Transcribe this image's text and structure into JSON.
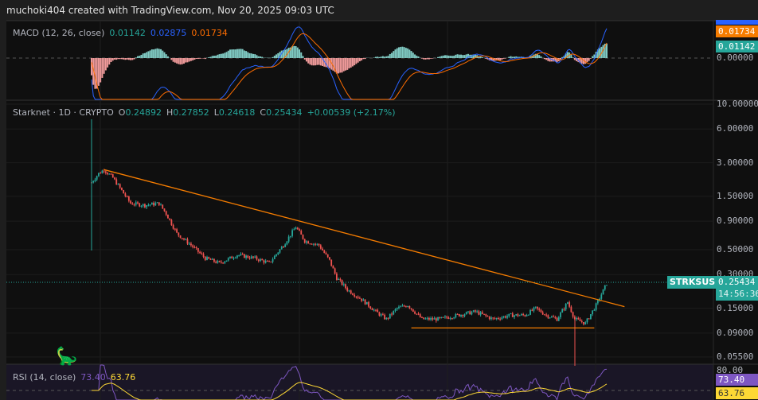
{
  "header": {
    "title": "muchoki404 created with TradingView.com, Nov 20, 2025 09:03 UTC"
  },
  "macd": {
    "label": "MACD (12, 26, close)",
    "hist": "0.01142",
    "macd": "0.02875",
    "signal": "0.01734",
    "axis_zero": "0.00000"
  },
  "price": {
    "symbol_line": "Starknet · 1D · CRYPTO",
    "o_label": "O",
    "o": "0.24892",
    "h_label": "H",
    "h": "0.27852",
    "l_label": "L",
    "l": "0.24618",
    "c_label": "C",
    "c": "0.25434",
    "change": "+0.00539 (+2.17%)",
    "ticker": "STRKSUSD",
    "last": "0.25434",
    "countdown": "14:56:36"
  },
  "rsi": {
    "label": "RSI (14, close)",
    "rsi": "73.40",
    "ma": "63.76",
    "axis_top": "80.00"
  },
  "colors": {
    "up": "#26a69a",
    "down": "#ef5350",
    "macd": "#2962ff",
    "signal": "#ff6d00",
    "rsi": "#7e57c2",
    "rsi_ma": "#fdd835",
    "trend": "#f57c00"
  },
  "chart_data": {
    "type": "candlestick",
    "scale": "log",
    "y_ticks": [
      "10.00000",
      "6.00000",
      "3.00000",
      "1.50000",
      "0.90000",
      "0.50000",
      "0.30000",
      "0.15000",
      "0.09000",
      "0.05500"
    ],
    "y_tick_values": [
      10,
      6,
      3,
      1.5,
      0.9,
      0.5,
      0.3,
      0.15,
      0.09,
      0.055
    ],
    "price_path": [
      [
        0,
        2.0
      ],
      [
        4,
        2.4
      ],
      [
        7,
        2.6
      ],
      [
        12,
        2.2
      ],
      [
        18,
        1.6
      ],
      [
        22,
        1.3
      ],
      [
        30,
        1.25
      ],
      [
        38,
        1.3
      ],
      [
        42,
        1.05
      ],
      [
        48,
        0.7
      ],
      [
        56,
        0.55
      ],
      [
        64,
        0.42
      ],
      [
        72,
        0.38
      ],
      [
        82,
        0.45
      ],
      [
        92,
        0.42
      ],
      [
        100,
        0.38
      ],
      [
        108,
        0.55
      ],
      [
        115,
        0.8
      ],
      [
        120,
        0.6
      ],
      [
        128,
        0.55
      ],
      [
        134,
        0.4
      ],
      [
        138,
        0.28
      ],
      [
        144,
        0.22
      ],
      [
        152,
        0.18
      ],
      [
        160,
        0.14
      ],
      [
        166,
        0.12
      ],
      [
        172,
        0.15
      ],
      [
        178,
        0.16
      ],
      [
        186,
        0.12
      ],
      [
        196,
        0.12
      ],
      [
        206,
        0.13
      ],
      [
        216,
        0.14
      ],
      [
        226,
        0.12
      ],
      [
        236,
        0.13
      ],
      [
        244,
        0.13
      ],
      [
        250,
        0.15
      ],
      [
        256,
        0.13
      ],
      [
        262,
        0.12
      ],
      [
        268,
        0.17
      ],
      [
        272,
        0.12
      ],
      [
        278,
        0.11
      ],
      [
        284,
        0.16
      ],
      [
        290,
        0.25
      ]
    ],
    "trendline": {
      "from": [
        7,
        2.6
      ],
      "to": [
        300,
        0.155
      ]
    },
    "support": {
      "from": [
        180,
        0.1
      ],
      "to": [
        283,
        0.1
      ]
    }
  }
}
